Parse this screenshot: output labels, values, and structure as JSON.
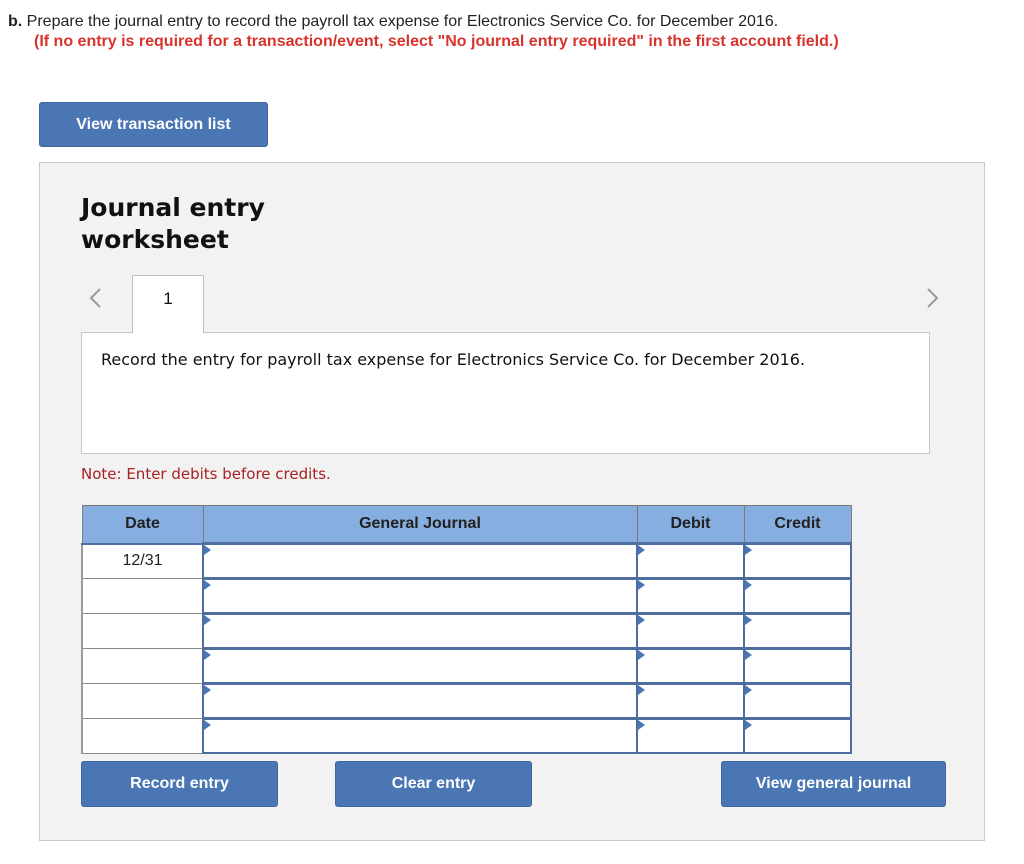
{
  "question": {
    "letter": "b.",
    "text": "Prepare the journal entry to record the payroll tax expense for Electronics Service Co. for December 2016.",
    "instruction": "(If no entry is required for a transaction/event, select \"No journal entry required\" in the first account field.)"
  },
  "buttons": {
    "view_transaction_list": "View transaction list",
    "record_entry": "Record entry",
    "clear_entry": "Clear entry",
    "view_general_journal": "View general journal"
  },
  "worksheet": {
    "title_line1": "Journal entry",
    "title_line2": "worksheet",
    "active_tab": "1",
    "prev_icon": "chevron-left-icon",
    "next_icon": "chevron-right-icon",
    "description": "Record the entry for payroll tax expense for Electronics Service Co. for December 2016.",
    "note": "Note: Enter debits before credits."
  },
  "table": {
    "headers": [
      "Date",
      "General Journal",
      "Debit",
      "Credit"
    ],
    "rows": [
      {
        "date": "12/31",
        "account": "",
        "debit": "",
        "credit": ""
      },
      {
        "date": "",
        "account": "",
        "debit": "",
        "credit": ""
      },
      {
        "date": "",
        "account": "",
        "debit": "",
        "credit": ""
      },
      {
        "date": "",
        "account": "",
        "debit": "",
        "credit": ""
      },
      {
        "date": "",
        "account": "",
        "debit": "",
        "credit": ""
      },
      {
        "date": "",
        "account": "",
        "debit": "",
        "credit": ""
      }
    ]
  },
  "colors": {
    "button_blue": "#4a76b3",
    "header_blue": "#87aee0",
    "instruction_red": "#d9332d",
    "note_red": "#a72222",
    "panel_bg": "#f2f2f2"
  }
}
